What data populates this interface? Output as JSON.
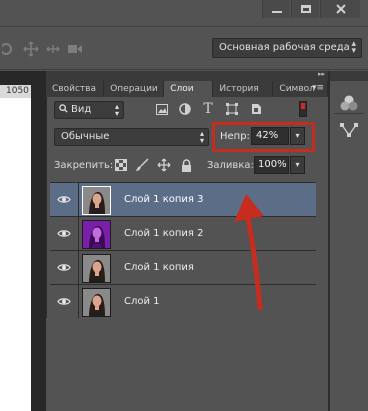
{
  "window_controls": {
    "minimize_icon": "minimize-icon",
    "maximize_icon": "maximize-icon",
    "close_icon": "close-icon"
  },
  "options_bar": {
    "tool_icons": [
      "3d-orbit-icon",
      "3d-pan-icon",
      "3d-slide-icon",
      "3d-camera-icon"
    ],
    "workspace": "Основная рабочая среда"
  },
  "ruler": {
    "mark": "1050"
  },
  "layers_panel": {
    "tabs": [
      {
        "label": "Свойства",
        "active": false
      },
      {
        "label": "Операции",
        "active": false
      },
      {
        "label": "Слои",
        "active": true
      },
      {
        "label": "История",
        "active": false
      },
      {
        "label": "Символ",
        "active": false
      }
    ],
    "filter": {
      "kind": "Вид"
    },
    "filter_icons": [
      "image-filter-icon",
      "adjustment-filter-icon",
      "type-filter-icon",
      "shape-filter-icon",
      "smart-object-filter-icon"
    ],
    "blend_mode": "Обычные",
    "opacity_label": "Непр:",
    "opacity_value": "42%",
    "lock_label": "Закрепить:",
    "lock_icons": [
      "lock-transparent-pixels-icon",
      "lock-image-pixels-icon",
      "lock-position-icon",
      "lock-all-icon"
    ],
    "fill_label": "Заливка:",
    "fill_value": "100%",
    "layers": [
      {
        "name": "Слой 1 копия 3",
        "selected": true,
        "tint": "normal"
      },
      {
        "name": "Слой 1 копия 2",
        "selected": false,
        "tint": "purple"
      },
      {
        "name": "Слой 1 копия",
        "selected": false,
        "tint": "normal"
      },
      {
        "name": "Слой 1",
        "selected": false,
        "tint": "normal"
      }
    ]
  },
  "annotations": {
    "highlight_color": "#c62d1f",
    "arrow_color": "#c62d1f"
  },
  "colors": {
    "panel_bg": "#535353",
    "selected_layer": "#5c6d87",
    "accent_red": "#c62d1f"
  }
}
